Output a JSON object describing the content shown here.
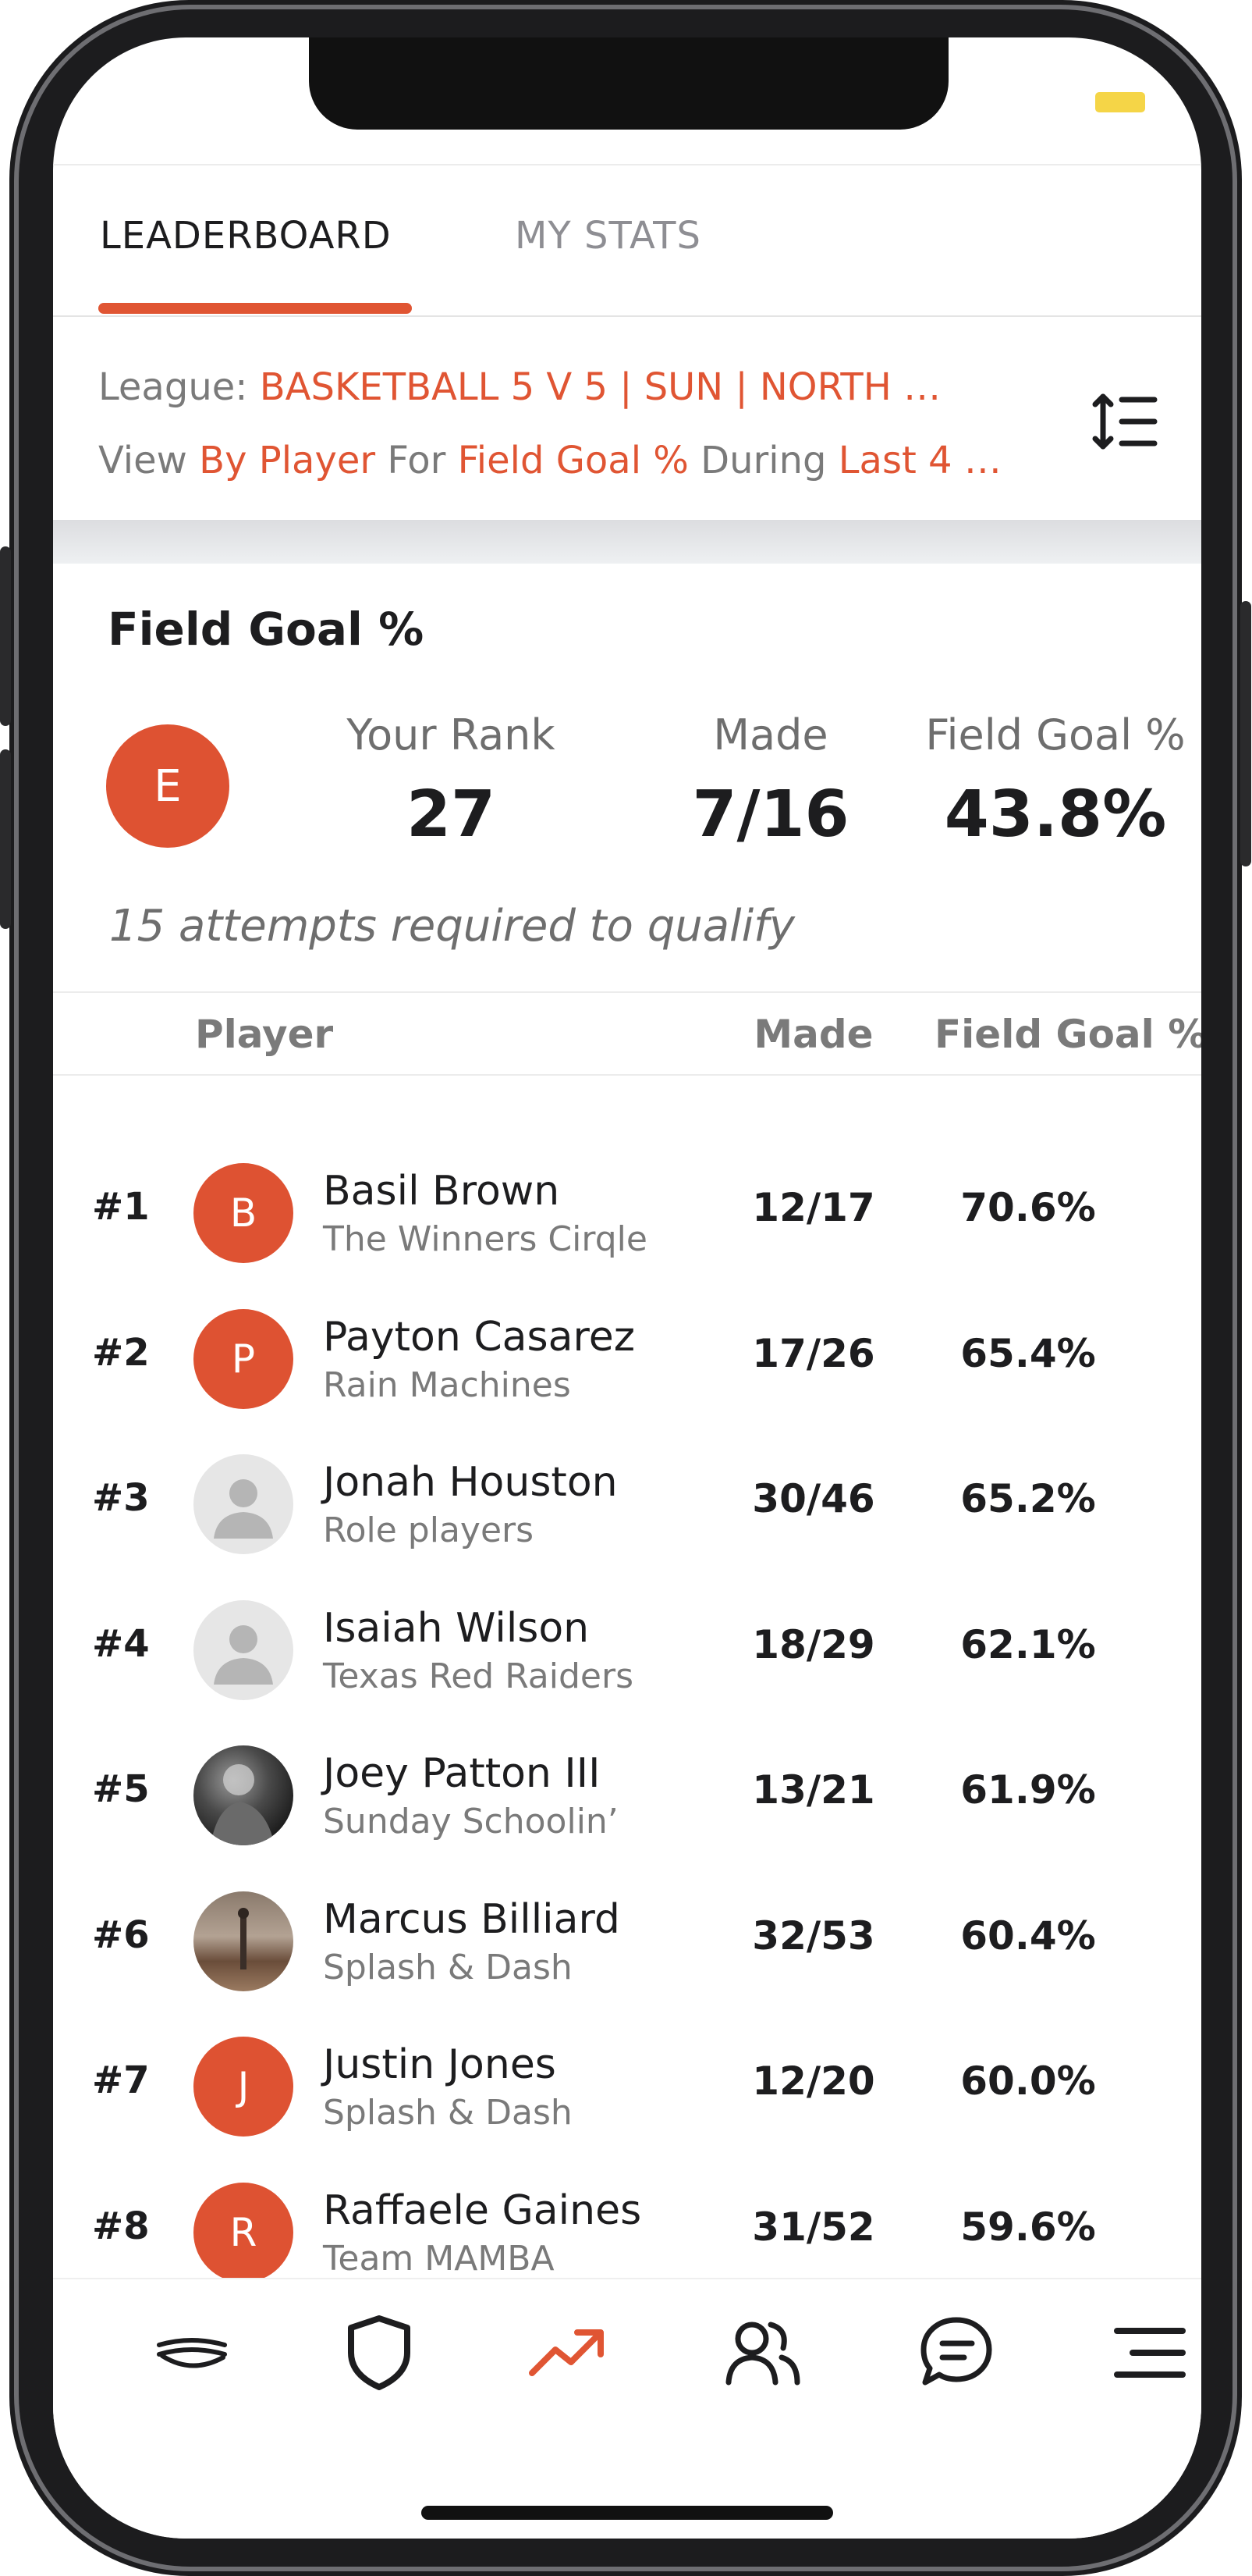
{
  "tabs": [
    {
      "label": "LEADERBOARD",
      "active": true
    },
    {
      "label": "MY STATS",
      "active": false
    }
  ],
  "filters": {
    "league_label": "League:",
    "league_value": "BASKETBALL 5 V 5 | SUN | NORTH …",
    "view_label": "View",
    "view_value": "By Player",
    "for_label": "For",
    "for_value": "Field Goal %",
    "during_label": "During",
    "during_value": "Last 4 …"
  },
  "summary": {
    "title": "Field Goal %",
    "avatar_initial": "E",
    "rank_label": "Your Rank",
    "rank_value": "27",
    "made_label": "Made",
    "made_value": "7/16",
    "pct_label": "Field Goal %",
    "pct_value": "43.8%",
    "qualify_note": "15 attempts required to qualify"
  },
  "table": {
    "headers": {
      "player": "Player",
      "made": "Made",
      "pct": "Field Goal %"
    },
    "rows": [
      {
        "rank": "#1",
        "initial": "B",
        "avatar": "letter",
        "name": "Basil Brown",
        "team": "The Winners Cirqle",
        "made": "12/17",
        "pct": "70.6%"
      },
      {
        "rank": "#2",
        "initial": "P",
        "avatar": "letter",
        "name": "Payton Casarez",
        "team": "Rain Machines",
        "made": "17/26",
        "pct": "65.4%"
      },
      {
        "rank": "#3",
        "initial": "",
        "avatar": "placeholder",
        "name": "Jonah Houston",
        "team": "Role players",
        "made": "30/46",
        "pct": "65.2%"
      },
      {
        "rank": "#4",
        "initial": "",
        "avatar": "placeholder",
        "name": "Isaiah Wilson",
        "team": "Texas Red Raiders",
        "made": "18/29",
        "pct": "62.1%"
      },
      {
        "rank": "#5",
        "initial": "",
        "avatar": "photo-dark",
        "name": "Joey Patton III",
        "team": "Sunday Schoolin’",
        "made": "13/21",
        "pct": "61.9%"
      },
      {
        "rank": "#6",
        "initial": "",
        "avatar": "photo-court",
        "name": "Marcus  Billiard",
        "team": "Splash & Dash",
        "made": "32/53",
        "pct": "60.4%"
      },
      {
        "rank": "#7",
        "initial": "J",
        "avatar": "letter",
        "name": "Justin Jones",
        "team": "Splash & Dash",
        "made": "12/20",
        "pct": "60.0%"
      },
      {
        "rank": "#8",
        "initial": "R",
        "avatar": "letter",
        "name": "Raffaele Gaines",
        "team": "Team MAMBA",
        "made": "31/52",
        "pct": "59.6%"
      }
    ]
  },
  "bottom_nav": [
    {
      "icon": "puck-icon",
      "active": false
    },
    {
      "icon": "shield-icon",
      "active": false
    },
    {
      "icon": "trending-up-icon",
      "active": true
    },
    {
      "icon": "users-icon",
      "active": false
    },
    {
      "icon": "chat-icon",
      "active": false
    },
    {
      "icon": "menu-icon",
      "active": false
    }
  ],
  "colors": {
    "accent": "#e05533",
    "text": "#1d1d1f",
    "muted": "#7a7a7a"
  }
}
